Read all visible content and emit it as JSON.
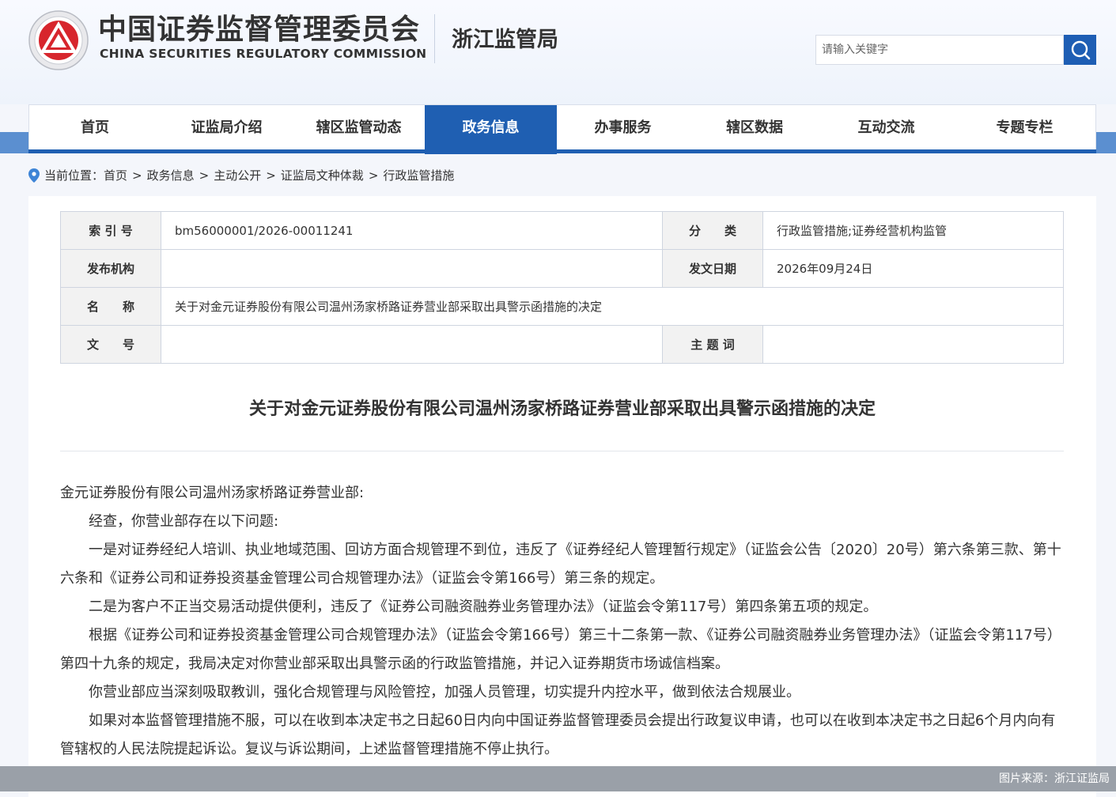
{
  "header": {
    "title_cn": "中国证券监督管理委员会",
    "title_en": "CHINA SECURITIES REGULATORY COMMISSION",
    "bureau": "浙江监管局",
    "search_placeholder": "请输入关键字",
    "accent_color": "#1f5fb2"
  },
  "nav": {
    "items": [
      {
        "label": "首页"
      },
      {
        "label": "证监局介绍"
      },
      {
        "label": "辖区监管动态"
      },
      {
        "label": "政务信息",
        "active": true
      },
      {
        "label": "办事服务"
      },
      {
        "label": "辖区数据"
      },
      {
        "label": "互动交流"
      },
      {
        "label": "专题专栏"
      }
    ]
  },
  "breadcrumb": {
    "prefix": "当前位置：",
    "items": [
      "首页",
      "政务信息",
      "主动公开",
      "证监局文种体裁",
      "行政监管措施"
    ],
    "separator": ">"
  },
  "meta": {
    "index_label": "索 引 号",
    "index_value": "bm56000001/2026-00011241",
    "category_label": "分　　类",
    "category_value": "行政监管措施;证券经营机构监管",
    "issuer_label": "发布机构",
    "issuer_value": "",
    "date_label": "发文日期",
    "date_value": "2026年09月24日",
    "name_label": "名　　称",
    "name_value": "关于对金元证券股份有限公司温州汤家桥路证券营业部采取出具警示函措施的决定",
    "docno_label": "文　　号",
    "docno_value": "",
    "keywords_label": "主 题 词",
    "keywords_value": ""
  },
  "document": {
    "title": "关于对金元证券股份有限公司温州汤家桥路证券营业部采取出具警示函措施的决定",
    "salutation": "金元证券股份有限公司温州汤家桥路证券营业部:",
    "paragraphs": [
      "经查，你营业部存在以下问题:",
      "一是对证券经纪人培训、执业地域范围、回访方面合规管理不到位，违反了《证券经纪人管理暂行规定》（证监会公告〔2020〕20号）第六条第三款、第十六条和《证券公司和证券投资基金管理公司合规管理办法》（证监会令第166号）第三条的规定。",
      "二是为客户不正当交易活动提供便利，违反了《证券公司融资融券业务管理办法》（证监会令第117号）第四条第五项的规定。",
      "根据《证券公司和证券投资基金管理公司合规管理办法》（证监会令第166号）第三十二条第一款、《证券公司融资融券业务管理办法》（证监会令第117号）第四十九条的规定，我局决定对你营业部采取出具警示函的行政监管措施，并记入证券期货市场诚信档案。",
      "你营业部应当深刻吸取教训，强化合规管理与风险管控，加强人员管理，切实提升内控水平，做到依法合规展业。",
      "如果对本监督管理措施不服，可以在收到本决定书之日起60日内向中国证券监督管理委员会提出行政复议申请，也可以在收到本决定书之日起6个月内向有管辖权的人民法院提起诉讼。复议与诉讼期间，上述监督管理措施不停止执行。"
    ]
  },
  "source_note": "图片来源：浙江证监局"
}
